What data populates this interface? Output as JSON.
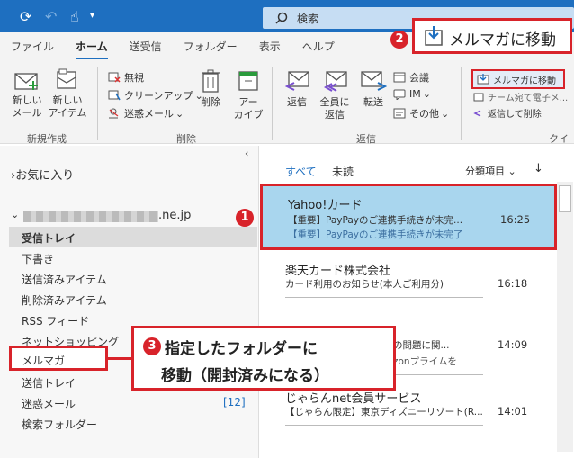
{
  "titlebar": {
    "search_label": "検索"
  },
  "tabs": [
    "ファイル",
    "ホーム",
    "送受信",
    "フォルダー",
    "表示",
    "ヘルプ"
  ],
  "ribbon": {
    "new_mail": "新しい\nメール",
    "new_item": "新しい\nアイテム",
    "new_item_arrow": "⌄",
    "ignore": "無視",
    "cleanup": "クリーンアップ",
    "junk": "迷惑メール",
    "delete": "削除",
    "archive": "アー\nカイブ",
    "reply": "返信",
    "reply_all": "全員に\n返信",
    "forward": "転送",
    "meeting": "会議",
    "im": "IM",
    "more": "その他",
    "move_to_melmaga": "メルマガに移動",
    "team_email": "チーム宛て電子メ...",
    "reply_delete": "返信して削除",
    "group_new": "新規作成",
    "group_delete": "削除",
    "group_respond": "返信",
    "group_quick": "クイッ"
  },
  "callout2": {
    "number": "2",
    "label": "メルマガに移動"
  },
  "callout3": {
    "number": "3",
    "line1": "指定したフォルダーに",
    "line2": "移動（開封済みになる）"
  },
  "callout1": {
    "number": "1"
  },
  "folders": {
    "favorites": "お気に入り",
    "account": ".ne.jp",
    "items": [
      "受信トレイ",
      "下書き",
      "送信済みアイテム",
      "削除済みアイテム",
      "RSS フィード",
      "ネットショッピング",
      "メルマガ",
      "送信トレイ",
      "迷惑メール",
      "検索フォルダー"
    ],
    "junk_count": "[12]"
  },
  "msglist": {
    "filter_all": "すべて",
    "filter_unread": "未読",
    "sort_label": "分類項目",
    "messages": [
      {
        "sender": "Yahoo!カード",
        "subject": "【重要】PayPayのご連携手続きが未完...",
        "preview": "【重要】PayPayのご連携手続きが未完了",
        "time": "16:25"
      },
      {
        "sender": "楽天カード株式会社",
        "subject": "カード利用のお知らせ(本人ご利用分)",
        "preview": "",
        "time": "16:18"
      },
      {
        "sender": "",
        "subject": "の問題に関...",
        "preview": "zonプライムを",
        "time": "14:09"
      },
      {
        "sender": "じゃらんnet会員サービス",
        "subject": "【じゃらん限定】東京ディズニーリゾート(R...",
        "preview": "",
        "time": "14:01"
      }
    ]
  }
}
